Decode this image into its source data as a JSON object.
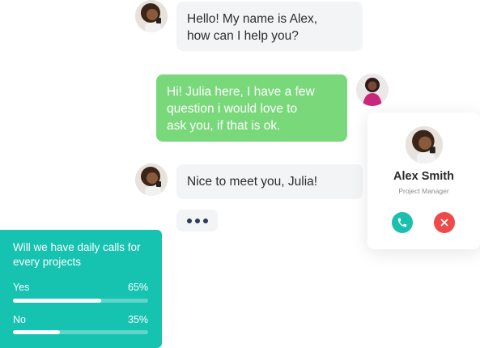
{
  "chat": {
    "messages": [
      {
        "sender": "agent",
        "lines": [
          "Hello! My name is Alex,",
          "how can I help you?"
        ]
      },
      {
        "sender": "user",
        "lines": [
          "Hi! Julia here, I have a few",
          "question i would love to",
          "ask you, if that is ok."
        ]
      },
      {
        "sender": "agent",
        "lines": [
          "Nice to meet you, Julia!"
        ]
      }
    ],
    "typing_icon": "ellipsis-icon"
  },
  "call_card": {
    "name": "Alex Smith",
    "role": "Project Manager",
    "accept_icon": "phone-icon",
    "decline_icon": "close-icon"
  },
  "poll": {
    "question": "Will we have daily calls for every projects",
    "options": [
      {
        "label": "Yes",
        "percent_text": "65%",
        "fraction": 0.65
      },
      {
        "label": "No",
        "percent_text": "35%",
        "fraction": 0.35
      }
    ]
  },
  "colors": {
    "user_bubble": "#79d97a",
    "agent_bubble": "#f3f4f6",
    "poll_bg": "#16c3b1",
    "accept": "#1bbfae",
    "decline": "#ef4a4a"
  }
}
